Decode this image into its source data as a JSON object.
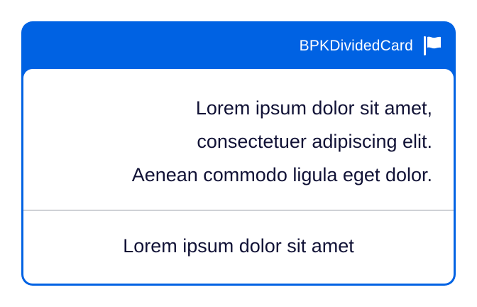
{
  "card": {
    "header_label": "BPKDividedCard",
    "header_icon": "flag-icon",
    "primary_lines": [
      "Lorem ipsum dolor sit amet,",
      "consectetuer adipiscing elit.",
      "Aenean commodo ligula eget dolor."
    ],
    "secondary_text": "Lorem ipsum dolor sit amet"
  },
  "colors": {
    "accent": "#0062e3",
    "text": "#111236",
    "divider": "#cfd2d6",
    "background": "#ffffff"
  }
}
